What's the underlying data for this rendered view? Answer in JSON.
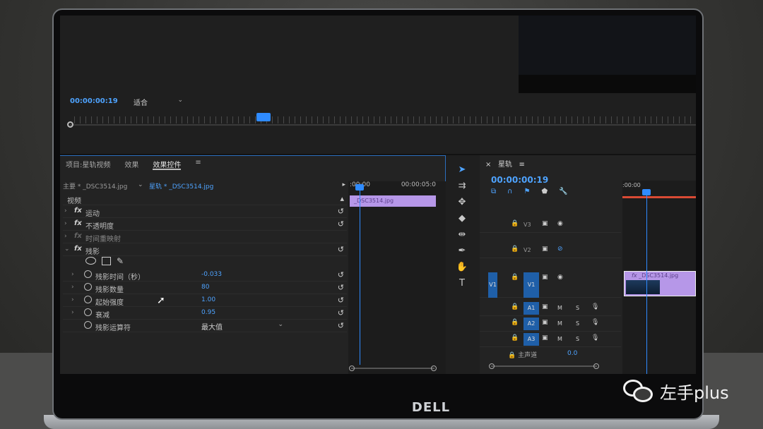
{
  "program_monitor": {
    "timecode": "00:00:00:19",
    "fit_label": "适合"
  },
  "effect_controls": {
    "tabs": [
      "项目:星轨视频",
      "效果",
      "效果控件"
    ],
    "active_tab": "效果控件",
    "master_clip": "主要 * _DSC3514.jpg",
    "sequence_clip": "星轨 * _DSC3514.jpg",
    "section": "视频",
    "effects": [
      {
        "name": "运动"
      },
      {
        "name": "不透明度"
      },
      {
        "name": "时间重映射"
      },
      {
        "name": "残影"
      }
    ],
    "params": [
      {
        "name": "残影时间（秒）",
        "value": "-0.033"
      },
      {
        "name": "残影数量",
        "value": "80"
      },
      {
        "name": "起始强度",
        "value": "1.00"
      },
      {
        "name": "衰减",
        "value": "0.95"
      },
      {
        "name": "残影运算符",
        "value": "最大值"
      }
    ],
    "mini_timeline": {
      "start": ":00:00",
      "end": "00:00:05:0",
      "clip": "_DSC3514.jpg"
    }
  },
  "timeline": {
    "sequence_name": "星轨",
    "timecode": "00:00:00:19",
    "ruler_start": ":00:00",
    "video_tracks": [
      {
        "name": "V3",
        "source": ""
      },
      {
        "name": "V2",
        "source": ""
      },
      {
        "name": "V1",
        "source": "V1"
      }
    ],
    "audio_tracks": [
      {
        "name": "A1",
        "mute": "M",
        "solo": "S"
      },
      {
        "name": "A2",
        "mute": "M",
        "solo": "S"
      },
      {
        "name": "A3",
        "mute": "M",
        "solo": "S"
      }
    ],
    "master_label": "主声道",
    "master_value": "0.0",
    "clip_label": "_DSC3514.jpg",
    "fx_badge": "fx"
  },
  "brand": "DELL",
  "watermark": "左手plus",
  "icons": {
    "selection": "arrow-icon",
    "track_select": "track-select-icon",
    "ripple": "ripple-edit-icon",
    "razor": "razor-icon",
    "slip": "slip-icon",
    "pen": "pen-icon",
    "hand": "hand-icon",
    "type": "type-icon"
  }
}
